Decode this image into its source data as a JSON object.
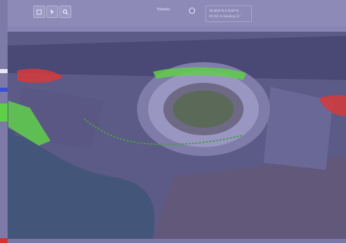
{
  "toolbar": {
    "scene_title": "Estadio",
    "coords_line1": "38.4826°N  0.3648°W",
    "coords_line2": "Alt 412 m   Heading 12°"
  },
  "icons": [
    "layers-icon",
    "navigate-icon",
    "search-icon",
    "globe-icon"
  ],
  "colors": {
    "overlay": "#6e6a9c",
    "highlight_green": "#5fcf4a",
    "highlight_red": "#d63a3a",
    "highlight_blue": "#3a4fd6"
  }
}
